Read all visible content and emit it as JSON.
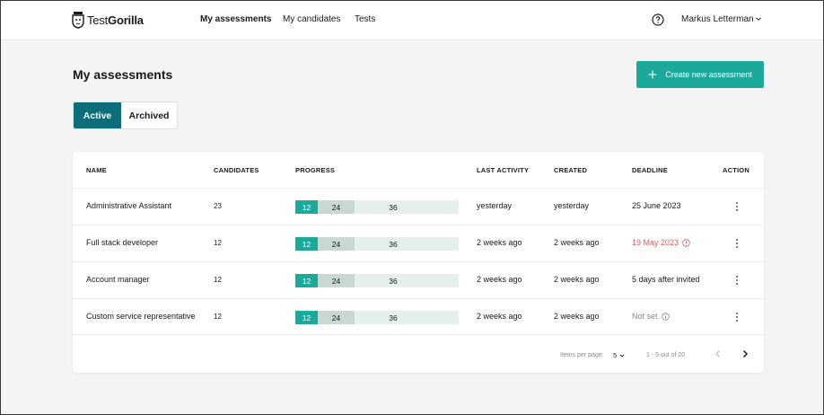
{
  "app": {
    "logo": {
      "part1": "Test",
      "part2": "Gorilla"
    },
    "nav": [
      {
        "label": "My assessments",
        "active": true
      },
      {
        "label": "My candidates",
        "active": false
      },
      {
        "label": "Tests",
        "active": false
      }
    ],
    "user": {
      "name": "Markus Letterman"
    }
  },
  "page": {
    "title": "My assessments",
    "create_button": "Create new assessment",
    "tabs": {
      "active": "Active",
      "archived": "Archived"
    }
  },
  "table": {
    "columns": [
      "NAME",
      "CANDIDATES",
      "PROGRESS",
      "LAST ACTIVITY",
      "CREATED",
      "DEADLINE",
      "ACTION"
    ],
    "rows": [
      {
        "name": "Administrative Assistant",
        "candidates": "23",
        "progress": [
          "12",
          "24",
          "36"
        ],
        "last_activity": "yesterday",
        "created": "yesterday",
        "deadline": "25 June 2023",
        "deadline_style": "normal"
      },
      {
        "name": "Full stack developer",
        "candidates": "12",
        "progress": [
          "12",
          "24",
          "36"
        ],
        "last_activity": "2 weeks ago",
        "created": "2 weeks ago",
        "deadline": "19 May 2023",
        "deadline_style": "overdue"
      },
      {
        "name": "Account manager",
        "candidates": "12",
        "progress": [
          "12",
          "24",
          "36"
        ],
        "last_activity": "2 weeks ago",
        "created": "2 weeks ago",
        "deadline": "5 days after invited",
        "deadline_style": "normal"
      },
      {
        "name": "Custom service representative",
        "candidates": "12",
        "progress": [
          "12",
          "24",
          "36"
        ],
        "last_activity": "2 weeks ago",
        "created": "2 weeks ago",
        "deadline": "Not set",
        "deadline_style": "muted"
      }
    ]
  },
  "pagination": {
    "items_per_page_label": "Items per page:",
    "items_per_page_value": "5",
    "range_text": "1 - 5 out of 20"
  },
  "colors": {
    "accent": "#1ba99a",
    "tab_active": "#0d6d79",
    "overdue": "#e05a5a"
  }
}
